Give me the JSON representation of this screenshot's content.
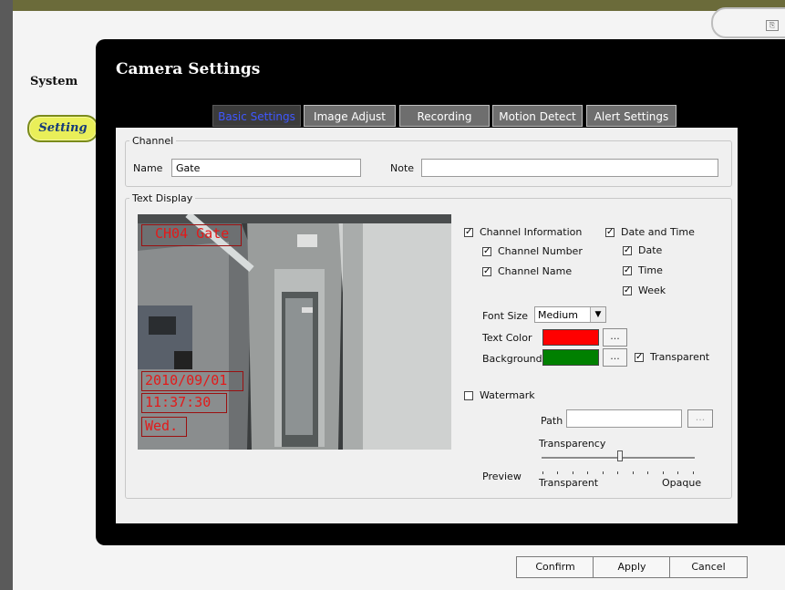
{
  "sidebar": {
    "system_label": "System",
    "setting_label": "Setting"
  },
  "panel": {
    "title": "Camera Settings"
  },
  "tabs": [
    {
      "label": "Basic Settings",
      "active": true
    },
    {
      "label": "Image Adjust",
      "active": false
    },
    {
      "label": "Recording",
      "active": false
    },
    {
      "label": "Motion Detect",
      "active": false
    },
    {
      "label": "Alert Settings",
      "active": false
    }
  ],
  "channel": {
    "legend": "Channel",
    "name_label": "Name",
    "name_value": "Gate",
    "note_label": "Note",
    "note_value": ""
  },
  "text_display": {
    "legend": "Text Display",
    "overlay": {
      "channel": "CH04 Gate",
      "date": "2010/09/01",
      "time": "11:37:30",
      "week": "Wed."
    },
    "channel_information": {
      "label": "Channel Information",
      "checked": true
    },
    "channel_number": {
      "label": "Channel Number",
      "checked": true
    },
    "channel_name": {
      "label": "Channel Name",
      "checked": true
    },
    "date_and_time": {
      "label": "Date and Time",
      "checked": true
    },
    "date": {
      "label": "Date",
      "checked": true
    },
    "time": {
      "label": "Time",
      "checked": true
    },
    "week": {
      "label": "Week",
      "checked": true
    },
    "font_size_label": "Font Size",
    "font_size_value": "Medium",
    "text_color_label": "Text Color",
    "text_color": "#ff0000",
    "background_label": "Background",
    "background_color": "#008000",
    "browse_label": "...",
    "transparent": {
      "label": "Transparent",
      "checked": true
    },
    "watermark": {
      "label": "Watermark",
      "checked": false
    },
    "path_label": "Path",
    "path_value": "",
    "transparency_label": "Transparency",
    "transparency_level": 0.5,
    "preview_label": "Preview",
    "slider_min_label": "Transparent",
    "slider_max_label": "Opaque"
  },
  "footer": {
    "confirm": "Confirm",
    "apply": "Apply",
    "cancel": "Cancel"
  },
  "colors": {
    "panel_bg": "#000000",
    "setting_pill": "#e9ef59",
    "active_tab_text": "#3f57ff",
    "osd_text": "#e21a1a"
  }
}
